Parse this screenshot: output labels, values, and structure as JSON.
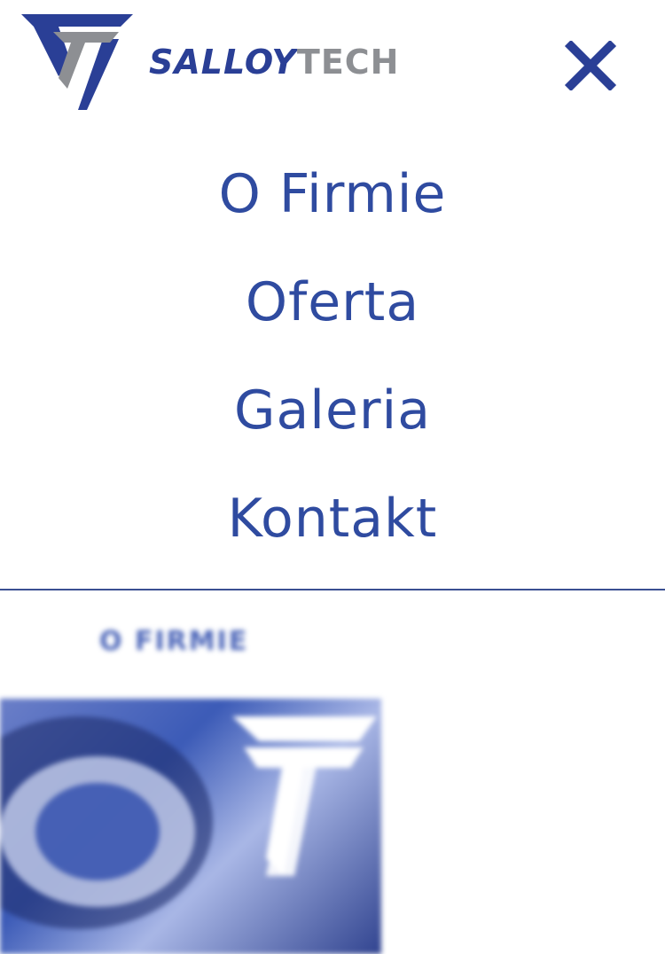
{
  "header": {
    "logo_word_primary": "SALLOY",
    "logo_word_secondary": "TECH",
    "close_icon": "close-icon"
  },
  "colors": {
    "brand_blue": "#2a3f96",
    "menu_link": "#2f4ba0",
    "logo_gray": "#8d8f93",
    "divider": "#3a4f92"
  },
  "menu": {
    "items": [
      {
        "label": "O Firmie"
      },
      {
        "label": "Oferta"
      },
      {
        "label": "Galeria"
      },
      {
        "label": "Kontakt"
      }
    ]
  },
  "page": {
    "section_title": "O FIRMIE"
  }
}
